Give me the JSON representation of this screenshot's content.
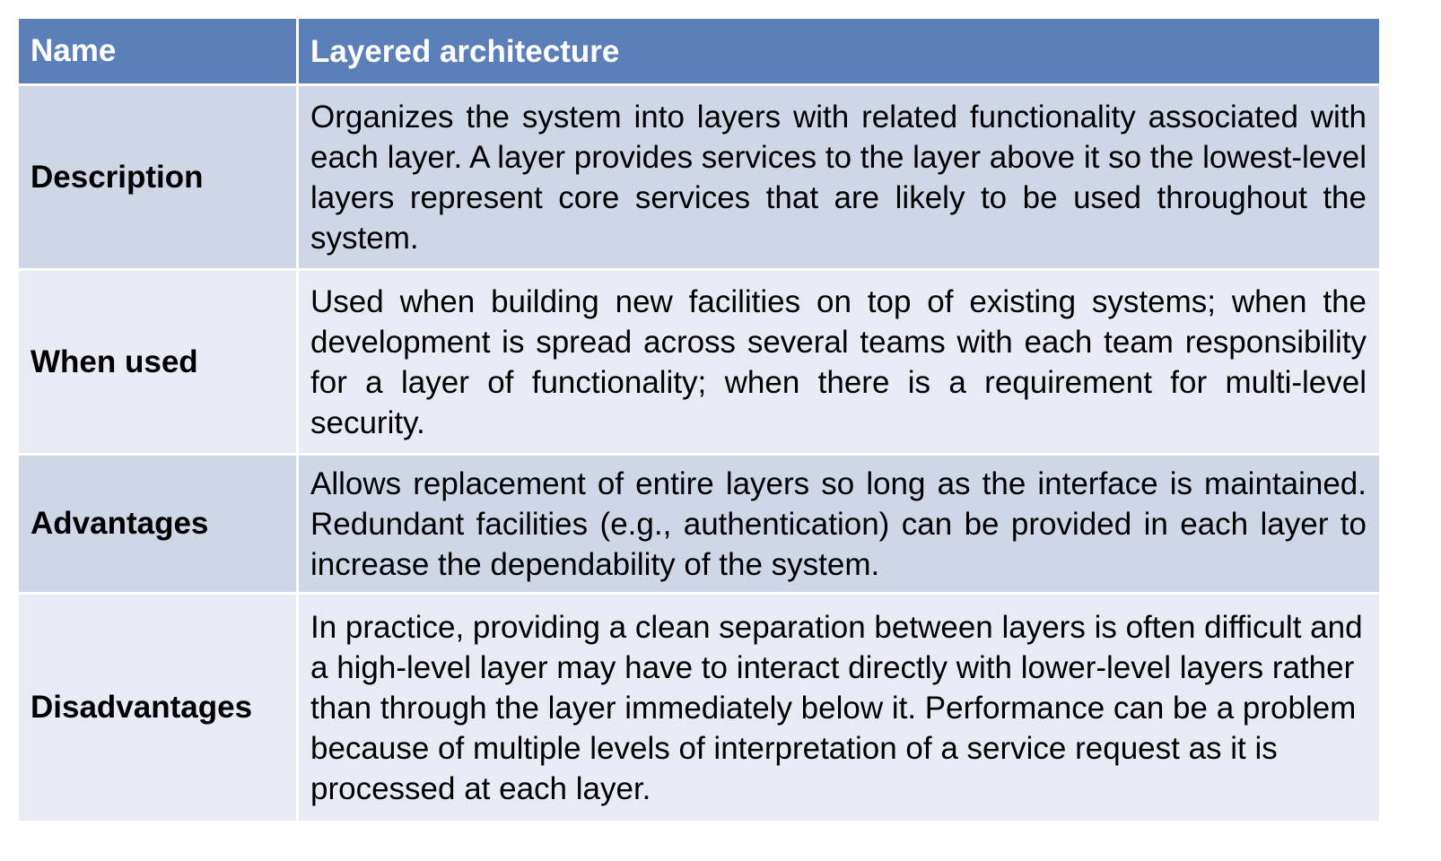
{
  "table": {
    "header": {
      "name": "Name",
      "value": "Layered architecture"
    },
    "rows": [
      {
        "label": "Description",
        "text": "Organizes the system into layers with related functionality associated with each layer. A layer provides services to the layer above it so the lowest-level layers represent core services that are likely to be used throughout the system."
      },
      {
        "label": "When used",
        "text": "Used when building new facilities on top of existing systems; when the development is spread across several teams with each team responsibility for a layer of functionality; when there is a requirement for multi-level security."
      },
      {
        "label": "Advantages",
        "text": "Allows replacement of entire layers so long as the interface is maintained. Redundant facilities (e.g., authentication) can be provided in each layer to increase the dependability of the system."
      },
      {
        "label": "Disadvantages",
        "text": "In practice, providing a clean separation between layers is often difficult and a high-level layer may have to interact directly with lower-level layers rather than through the layer immediately below it. Performance can be a problem because of multiple levels of interpretation of a service request as it is processed at each layer."
      }
    ]
  },
  "colors": {
    "header_bg": "#5b7fb8",
    "row_dark": "#cfd6e6",
    "row_light": "#e8ebf4",
    "header_text": "#ffffff"
  }
}
